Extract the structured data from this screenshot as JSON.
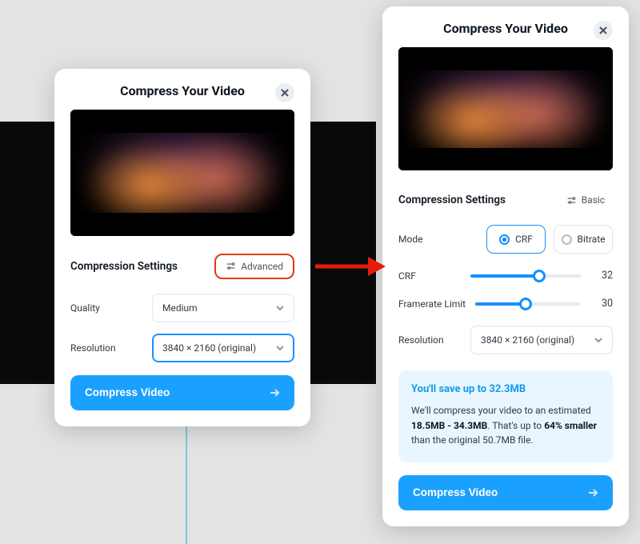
{
  "left": {
    "title": "Compress Your Video",
    "section_title": "Compression Settings",
    "toggle_label": "Advanced",
    "quality_label": "Quality",
    "quality_value": "Medium",
    "resolution_label": "Resolution",
    "resolution_value": "3840 × 2160 (original)",
    "cta": "Compress Video"
  },
  "right": {
    "title": "Compress Your Video",
    "section_title": "Compression Settings",
    "toggle_label": "Basic",
    "mode_label": "Mode",
    "mode_options": {
      "a": "CRF",
      "b": "Bitrate"
    },
    "crf_label": "CRF",
    "crf_value": "32",
    "crf_fill_pct": 62,
    "fps_label": "Framerate Limit",
    "fps_value": "30",
    "fps_fill_pct": 48,
    "resolution_label": "Resolution",
    "resolution_value": "3840 × 2160 (original)",
    "info_title": "You'll save up to 32.3MB",
    "info_line_prefix": "We'll compress your video to an estimated ",
    "info_range": "18.5MB - 34.3MB",
    "info_mid": ". That's up to ",
    "info_pct": "64% smaller",
    "info_suffix": " than the original 50.7MB file.",
    "cta": "Compress Video"
  }
}
